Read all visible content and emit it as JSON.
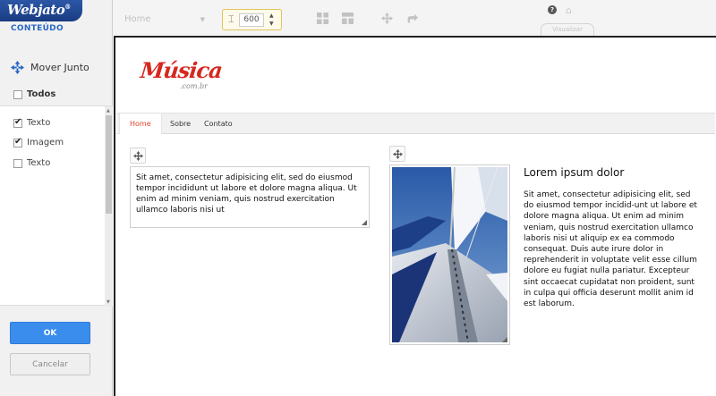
{
  "app": {
    "logo": "Webjato",
    "logo_reg": "®",
    "section": "CONTEÚDO"
  },
  "toolbar": {
    "page_select": "Home",
    "width_value": "600",
    "preview_label": "Visualizar"
  },
  "panel": {
    "move_together": "Mover Junto",
    "select_all": {
      "label": "Todos",
      "checked": false
    },
    "items": [
      {
        "label": "Texto",
        "checked": true
      },
      {
        "label": "Imagem",
        "checked": true
      },
      {
        "label": "Texto",
        "checked": false
      }
    ],
    "ok_label": "OK",
    "cancel_label": "Cancelar"
  },
  "site": {
    "logo_brand": "Música",
    "logo_domain": ".com.br",
    "nav": [
      "Home",
      "Sobre",
      "Contato"
    ],
    "text_block": "Sit amet, consectetur adipisicing elit, sed do eiusmod tempor incididunt ut  labore et dolore magna aliqua. Ut enim ad minim veniam, quis nostrud exercitation ullamco laboris nisi ut",
    "article_title": "Lorem ipsum dolor",
    "article_body": "Sit amet, consectetur adipisicing elit, sed do eiusmod tempor incidid-unt ut  labore et dolore magna aliqua. Ut enim ad minim veniam, quis nostrud exercitation ullamco laboris nisi ut aliquip ex ea commodo consequat. Duis aute irure dolor in reprehenderit in voluptate velit esse cillum dolore eu fugiat nulla pariatur. Excepteur sint occaecat cupidatat non proident, sunt in culpa qui officia deserunt mollit anim id est laborum."
  },
  "colors": {
    "brand_blue": "#2c57a6",
    "accent_blue": "#3b8ded",
    "logo_red": "#d6281f",
    "nav_active": "#e1452b"
  }
}
